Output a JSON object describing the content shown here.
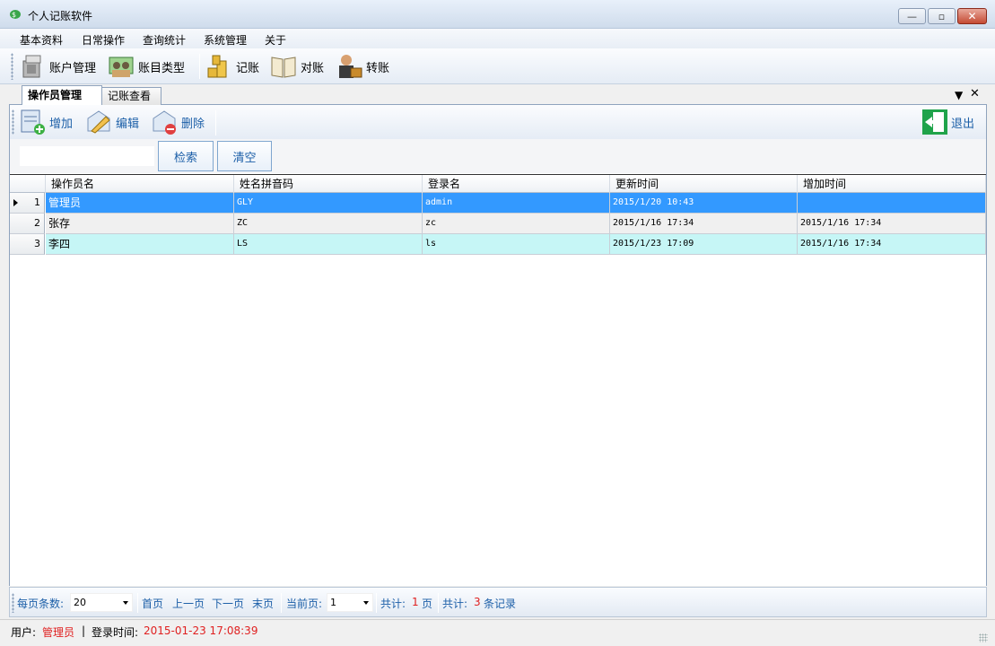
{
  "window": {
    "title": "个人记账软件"
  },
  "menu": [
    "基本资料",
    "日常操作",
    "查询统计",
    "系统管理",
    "关于"
  ],
  "toolbar": [
    {
      "label": "账户管理",
      "icon": "account-icon"
    },
    {
      "label": "账目类型",
      "icon": "category-icon"
    },
    {
      "label": "记账",
      "icon": "coins-icon"
    },
    {
      "label": "对账",
      "icon": "book-icon"
    },
    {
      "label": "转账",
      "icon": "transfer-icon"
    }
  ],
  "tabs": [
    {
      "label": "操作员管理",
      "active": true
    },
    {
      "label": "记账查看",
      "active": false
    }
  ],
  "actions": {
    "add": "增加",
    "edit": "编辑",
    "delete": "删除",
    "exit": "退出"
  },
  "search": {
    "value": "",
    "search_label": "检索",
    "clear_label": "清空"
  },
  "grid": {
    "columns": [
      "操作员名",
      "姓名拼音码",
      "登录名",
      "更新时间",
      "增加时间"
    ],
    "rows": [
      {
        "num": "1",
        "name": "管理员",
        "pinyin": "GLY",
        "login": "admin",
        "updated": "2015/1/20 10:43",
        "added": ""
      },
      {
        "num": "2",
        "name": "张存",
        "pinyin": "ZC",
        "login": "zc",
        "updated": "2015/1/16 17:34",
        "added": "2015/1/16 17:34"
      },
      {
        "num": "3",
        "name": "李四",
        "pinyin": "LS",
        "login": "ls",
        "updated": "2015/1/23 17:09",
        "added": "2015/1/16 17:34"
      }
    ]
  },
  "pager": {
    "page_size_label": "每页条数:",
    "page_size": "20",
    "first": "首页",
    "prev": "上一页",
    "next": "下一页",
    "last": "末页",
    "current_label": "当前页:",
    "current": "1",
    "total_pages_label": "共计:",
    "total_pages": "1",
    "pages_unit": "页",
    "total_records_label": "共计:",
    "total_records": "3",
    "records_unit": "条记录"
  },
  "status": {
    "user_label": "用户:",
    "user": "管理员",
    "separator": "|",
    "login_time_label": "登录时间:",
    "login_time": "2015-01-23 17:08:39"
  },
  "colors": {
    "selection": "#3399ff",
    "alt_row": "#c6f6f6",
    "link_blue": "#1c5fa8",
    "accent_red": "#e02020"
  }
}
